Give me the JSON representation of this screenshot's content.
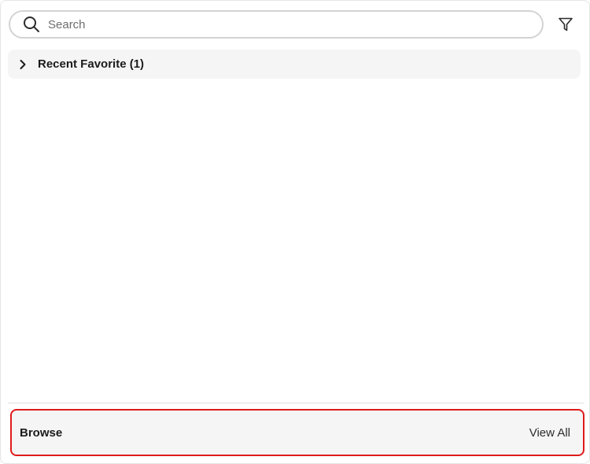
{
  "search": {
    "placeholder": "Search",
    "value": ""
  },
  "icons": {
    "search": "search-icon",
    "filter": "filter-icon",
    "expand": "chevron-right-icon"
  },
  "sections": [
    {
      "title": "Recent Favorite (1)",
      "expanded": false
    }
  ],
  "browse": {
    "label": "Browse",
    "view_all_label": "View All"
  },
  "colors": {
    "highlight": "#e01b1b",
    "section_bg": "#f5f5f5"
  }
}
